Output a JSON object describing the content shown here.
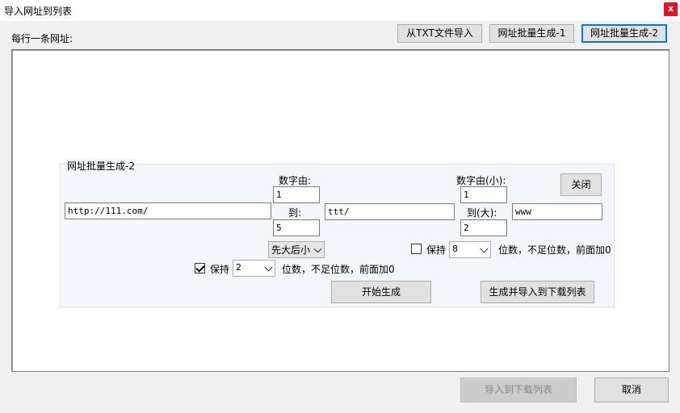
{
  "window": {
    "title": "导入网址到列表",
    "close_glyph": "x"
  },
  "header": {
    "label": "每行一条网址:",
    "buttons": {
      "import_txt": "从TXT文件导入",
      "batch1": "网址批量生成-1",
      "batch2": "网址批量生成-2"
    }
  },
  "panel": {
    "title": "网址批量生成-2",
    "close_button": "关闭",
    "num_from_label": "数字由:",
    "num_from_value": "1",
    "to_label": "到:",
    "num_to_value": "5",
    "num_from_small_label": "数字由(小):",
    "num_from_small_value": "1",
    "to_big_label": "到(大):",
    "num_to_big_value": "2",
    "url_prefix": "http://111.com/",
    "url_middle": "ttt/",
    "url_suffix": "www",
    "order_select": "先大后小",
    "keep1": {
      "label": "保持",
      "value": "8",
      "suffix": "位数，不足位数，前面加0",
      "checked": false
    },
    "keep2": {
      "label": "保持",
      "value": "2",
      "suffix": "位数，不足位数，前面加0",
      "checked": true
    },
    "start_button": "开始生成",
    "generate_import_button": "生成并导入到下载列表"
  },
  "footer": {
    "import_button": "导入到下载列表",
    "cancel_button": "取消"
  }
}
